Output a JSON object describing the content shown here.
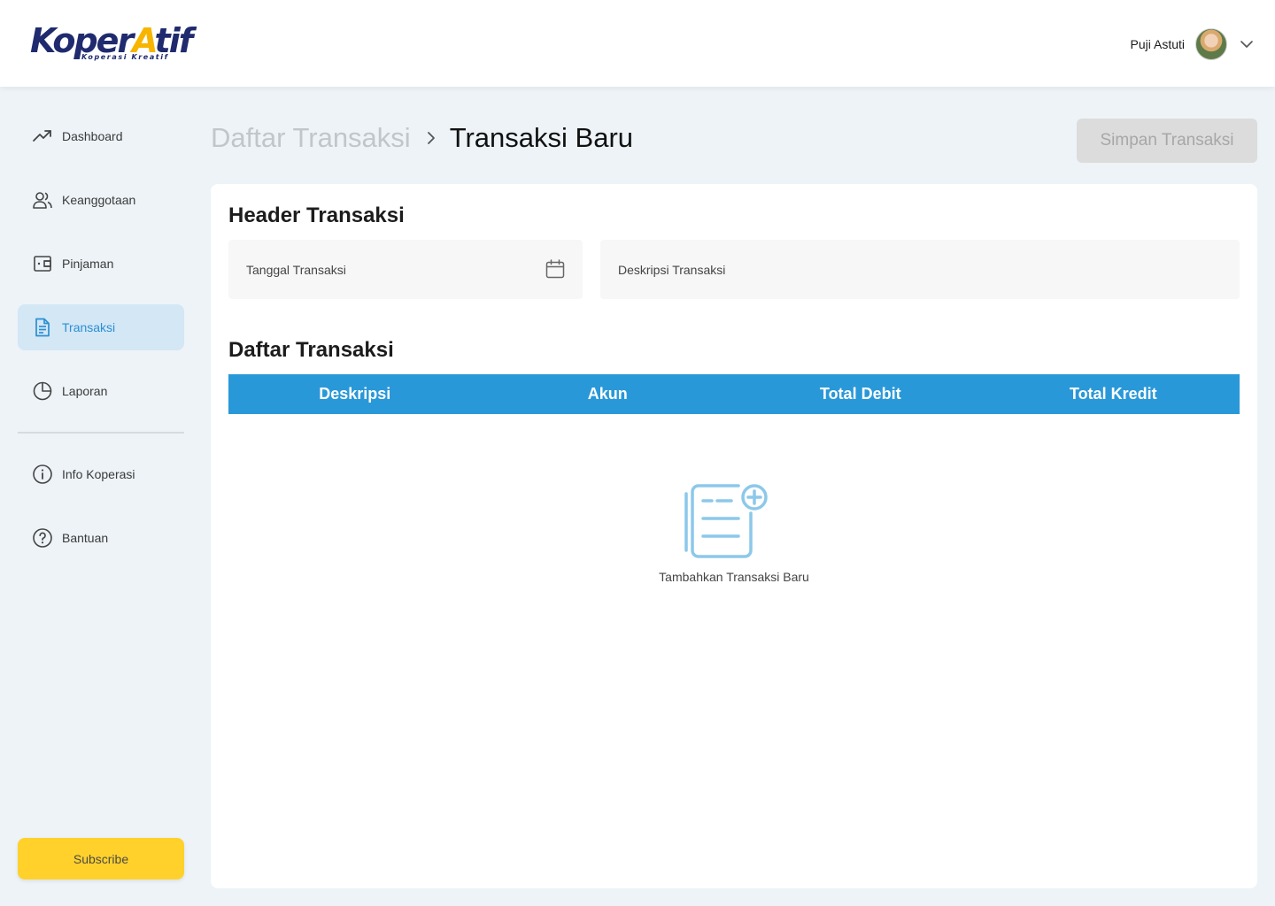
{
  "brand": {
    "logo_text": "KoperAtif",
    "logo_tagline": "Koperasi Kreatif"
  },
  "user": {
    "name": "Puji Astuti"
  },
  "sidebar": {
    "items": [
      {
        "label": "Dashboard",
        "icon": "trending-up-icon"
      },
      {
        "label": "Keanggotaan",
        "icon": "users-icon"
      },
      {
        "label": "Pinjaman",
        "icon": "wallet-icon"
      },
      {
        "label": "Transaksi",
        "icon": "document-icon",
        "active": true
      },
      {
        "label": "Laporan",
        "icon": "pie-chart-icon"
      }
    ],
    "secondary": [
      {
        "label": "Info Koperasi",
        "icon": "info-icon"
      },
      {
        "label": "Bantuan",
        "icon": "help-icon"
      }
    ],
    "subscribe_label": "Subscribe"
  },
  "breadcrumb": {
    "parent": "Daftar Transaksi",
    "current": "Transaksi Baru"
  },
  "actions": {
    "save_label": "Simpan Transaksi"
  },
  "header_section": {
    "title": "Header Transaksi",
    "date_placeholder": "Tanggal Transaksi",
    "description_placeholder": "Deskripsi Transaksi"
  },
  "list_section": {
    "title": "Daftar Transaksi",
    "columns": [
      "Deskripsi",
      "Akun",
      "Total Debit",
      "Total Kredit"
    ],
    "empty_label": "Tambahkan Transaksi Baru"
  },
  "colors": {
    "accent": "#2998d8",
    "active_bg": "#d3e7f5",
    "subscribe": "#ffd12a",
    "brand_navy": "#1f2b6e",
    "brand_yellow": "#f7b500"
  }
}
